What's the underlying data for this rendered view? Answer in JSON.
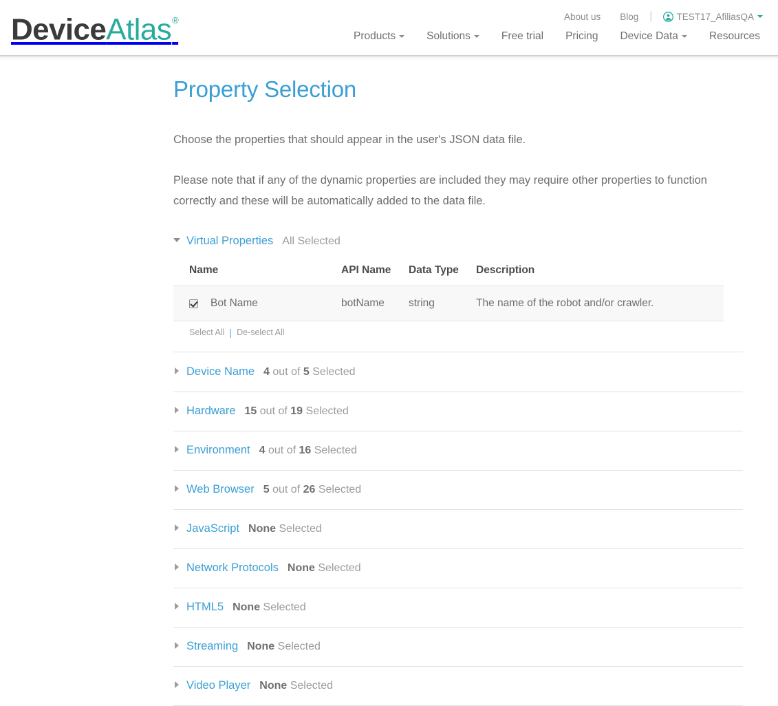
{
  "header": {
    "logo": {
      "part1": "Device",
      "part2": "Atlas",
      "registered": "®"
    },
    "util_nav": [
      {
        "label": "About us",
        "name": "about-us"
      },
      {
        "label": "Blog",
        "name": "blog"
      }
    ],
    "user": {
      "label": "TEST17_AfiliasQA",
      "icon": "user-icon"
    },
    "main_nav": [
      {
        "label": "Products",
        "caret": true
      },
      {
        "label": "Solutions",
        "caret": true
      },
      {
        "label": "Free trial",
        "caret": false
      },
      {
        "label": "Pricing",
        "caret": false
      },
      {
        "label": "Device Data",
        "caret": true
      },
      {
        "label": "Resources",
        "caret": false
      }
    ]
  },
  "main": {
    "title": "Property Selection",
    "paragraph1": "Choose the properties that should appear in the user's JSON data file.",
    "paragraph2": "Please note that if any of the dynamic properties are included they may require other properties to function correctly and these will be automatically added to the data file."
  },
  "expanded_group": {
    "name": "Virtual Properties",
    "count_text": "All Selected",
    "table": {
      "columns": [
        "Name",
        "API Name",
        "Data Type",
        "Description"
      ],
      "rows": [
        {
          "checked": true,
          "name": "Bot Name",
          "api_name": "botName",
          "data_type": "string",
          "description": "The name of the robot and/or crawler."
        }
      ]
    },
    "select_all": "Select All",
    "deselect_all": "De-select All"
  },
  "collapsed_groups": [
    {
      "name": "Device Name",
      "selected": "4",
      "middle": "out of",
      "total": "5",
      "suffix": "Selected"
    },
    {
      "name": "Hardware",
      "selected": "15",
      "middle": "out of",
      "total": "19",
      "suffix": "Selected"
    },
    {
      "name": "Environment",
      "selected": "4",
      "middle": "out of",
      "total": "16",
      "suffix": "Selected"
    },
    {
      "name": "Web Browser",
      "selected": "5",
      "middle": "out of",
      "total": "26",
      "suffix": "Selected"
    },
    {
      "name": "JavaScript",
      "selected": "None",
      "middle": "",
      "total": "",
      "suffix": "Selected"
    },
    {
      "name": "Network Protocols",
      "selected": "None",
      "middle": "",
      "total": "",
      "suffix": "Selected"
    },
    {
      "name": "HTML5",
      "selected": "None",
      "middle": "",
      "total": "",
      "suffix": "Selected"
    },
    {
      "name": "Streaming",
      "selected": "None",
      "middle": "",
      "total": "",
      "suffix": "Selected"
    },
    {
      "name": "Video Player",
      "selected": "None",
      "middle": "",
      "total": "",
      "suffix": "Selected"
    }
  ],
  "colors": {
    "brand_teal": "#27ab9f",
    "link_blue": "#3b9fd4",
    "text_gray": "#6c6d6f",
    "muted_gray": "#9b9b9b",
    "row_bg": "#f8f8f8"
  }
}
